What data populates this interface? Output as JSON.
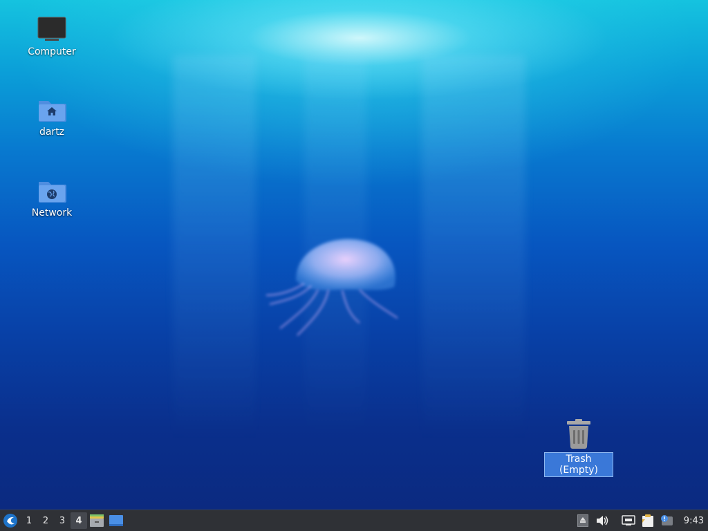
{
  "desktop": {
    "icons": [
      {
        "label": "Computer"
      },
      {
        "label": "dartz"
      },
      {
        "label": "Network"
      },
      {
        "label": "Trash (Empty)"
      }
    ]
  },
  "panel": {
    "workspaces": [
      "1",
      "2",
      "3",
      "4"
    ],
    "active_workspace": "4",
    "clock": "9:43"
  }
}
